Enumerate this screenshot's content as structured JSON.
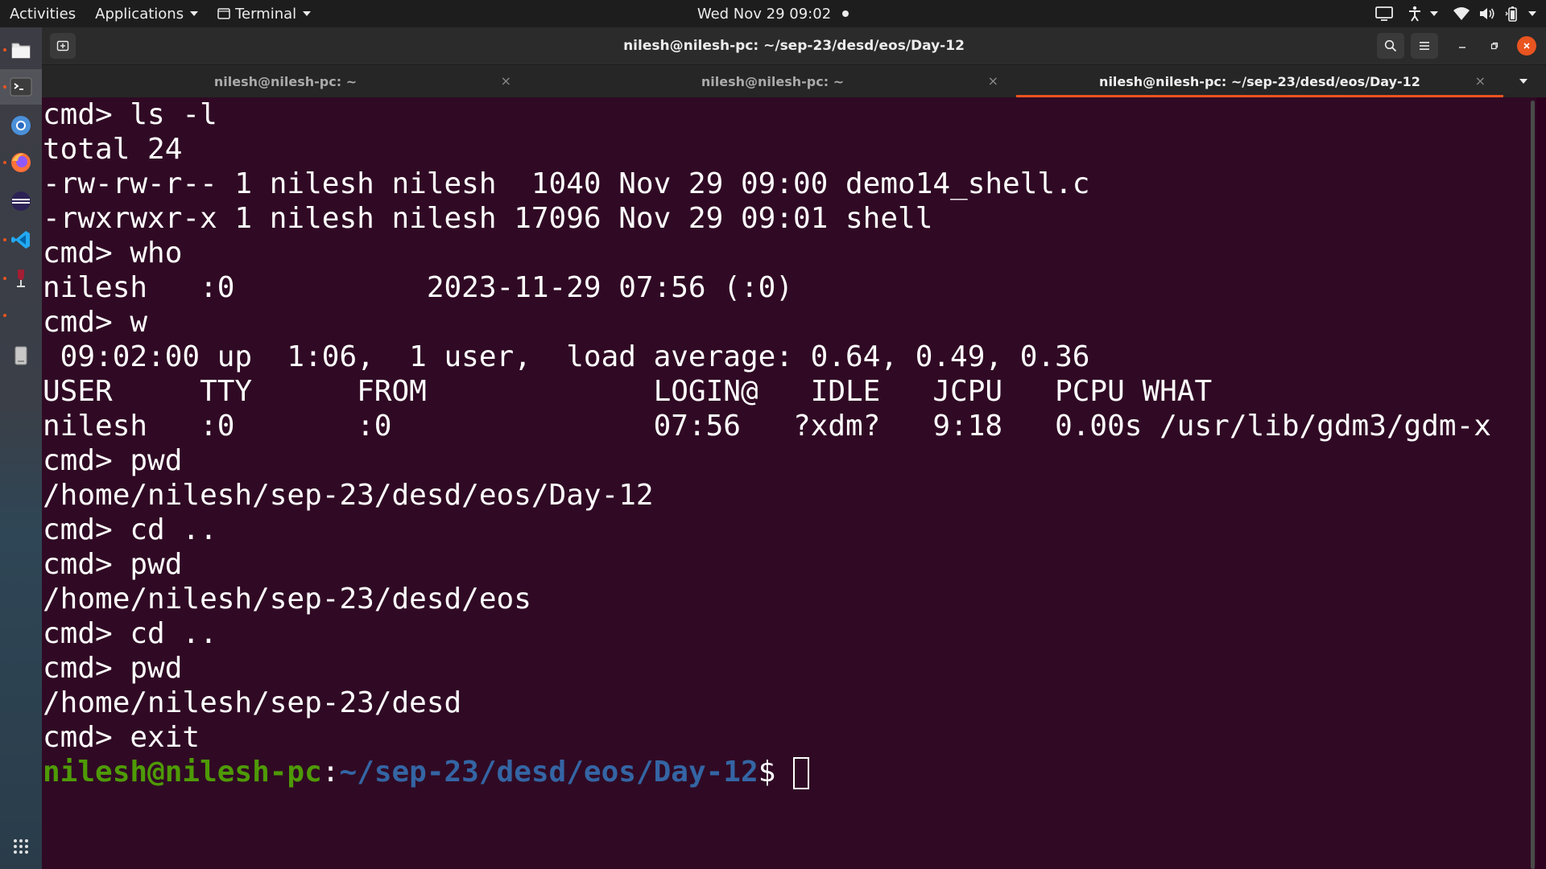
{
  "topbar": {
    "activities": "Activities",
    "applications": "Applications",
    "app_menu": "Terminal",
    "clock": "Wed Nov 29  09:02"
  },
  "dock": {
    "icons": [
      "files-icon",
      "terminal-icon",
      "chromium-icon",
      "firefox-icon",
      "eclipse-icon",
      "vscode-icon",
      "wine-icon",
      "usb-drive-icon",
      "show-apps-icon"
    ]
  },
  "window": {
    "title": "nilesh@nilesh-pc: ~/sep-23/desd/eos/Day-12"
  },
  "tabs": [
    {
      "label": "nilesh@nilesh-pc: ~",
      "active": false
    },
    {
      "label": "nilesh@nilesh-pc: ~",
      "active": false
    },
    {
      "label": "nilesh@nilesh-pc: ~/sep-23/desd/eos/Day-12",
      "active": true
    }
  ],
  "tab_close_glyph": "×",
  "colors": {
    "terminal_bg": "#300a24",
    "accent": "#e95420",
    "prompt_user": "#4e9a06",
    "prompt_path": "#3465a4"
  },
  "terminal": {
    "lines": [
      "cmd> ls -l",
      "total 24",
      "-rw-rw-r-- 1 nilesh nilesh  1040 Nov 29 09:00 demo14_shell.c",
      "-rwxrwxr-x 1 nilesh nilesh 17096 Nov 29 09:01 shell",
      "cmd> who",
      "nilesh   :0           2023-11-29 07:56 (:0)",
      "cmd> w",
      " 09:02:00 up  1:06,  1 user,  load average: 0.64, 0.49, 0.36",
      "USER     TTY      FROM             LOGIN@   IDLE   JCPU   PCPU WHAT",
      "nilesh   :0       :0               07:56   ?xdm?   9:18   0.00s /usr/lib/gdm3/gdm-x",
      "cmd> pwd",
      "/home/nilesh/sep-23/desd/eos/Day-12",
      "cmd> cd ..",
      "cmd> pwd",
      "/home/nilesh/sep-23/desd/eos",
      "cmd> cd ..",
      "cmd> pwd",
      "/home/nilesh/sep-23/desd",
      "cmd> exit"
    ],
    "prompt": {
      "user_host": "nilesh@nilesh-pc",
      "colon": ":",
      "path": "~/sep-23/desd/eos/Day-12",
      "dollar": "$"
    }
  }
}
